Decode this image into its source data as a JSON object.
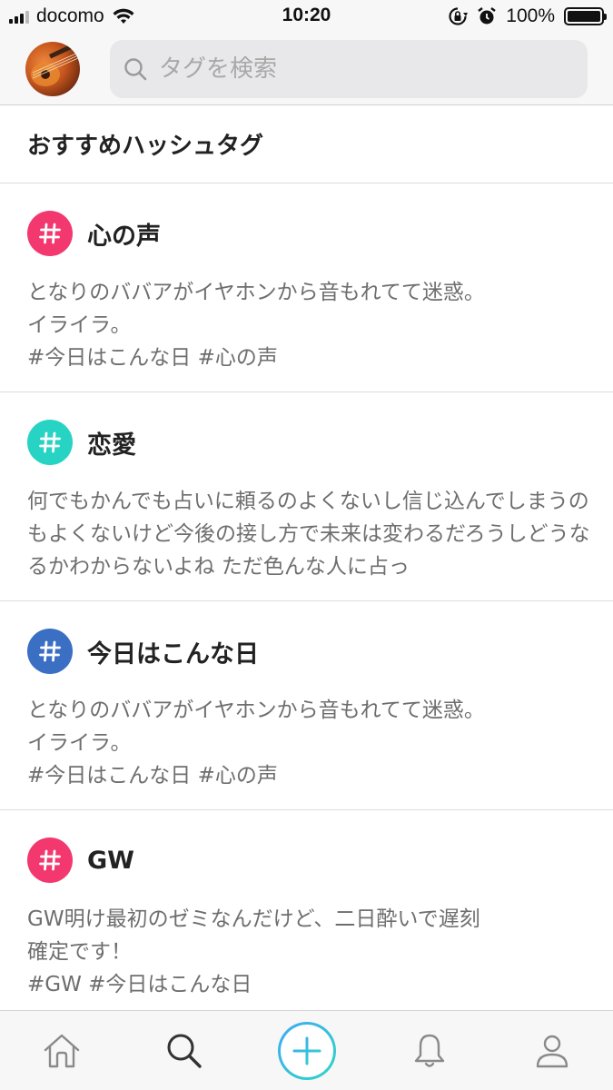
{
  "status_bar": {
    "carrier": "docomo",
    "time": "10:20",
    "battery_percent": "100%",
    "icons": [
      "signal-icon",
      "wifi-icon",
      "rotation-lock-icon",
      "alarm-icon",
      "battery-icon"
    ]
  },
  "header": {
    "avatar_icon": "guitar-avatar",
    "search_placeholder": "タグを検索"
  },
  "section": {
    "title": "おすすめハッシュタグ"
  },
  "colors": {
    "pink": "#f2386f",
    "teal": "#27d3c3",
    "blue": "#3a6fc4",
    "accent_gradient_start": "#3fa9f5",
    "accent_gradient_end": "#2fd6c3"
  },
  "tags": [
    {
      "name": "心の声",
      "color": "#f2386f",
      "excerpt": "となりのババアがイヤホンから音もれてて迷惑。\nイライラ。\n#今日はこんな日 #心の声"
    },
    {
      "name": "恋愛",
      "color": "#27d3c3",
      "excerpt": "何でもかんでも占いに頼るのよくないし信じ込んでしまうのもよくないけど今後の接し方で未来は変わるだろうしどうなるかわからないよね ただ色んな人に占っ"
    },
    {
      "name": "今日はこんな日",
      "color": "#3a6fc4",
      "excerpt": "となりのババアがイヤホンから音もれてて迷惑。\nイライラ。\n#今日はこんな日 #心の声"
    },
    {
      "name": "GW",
      "color": "#f2386f",
      "excerpt": "GW明け最初のゼミなんだけど、二日酔いで遅刻\n確定です！\n#GW #今日はこんな日"
    }
  ],
  "tabbar": {
    "tabs": [
      "home-icon",
      "search-icon",
      "plus-icon",
      "bell-icon",
      "profile-icon"
    ]
  }
}
